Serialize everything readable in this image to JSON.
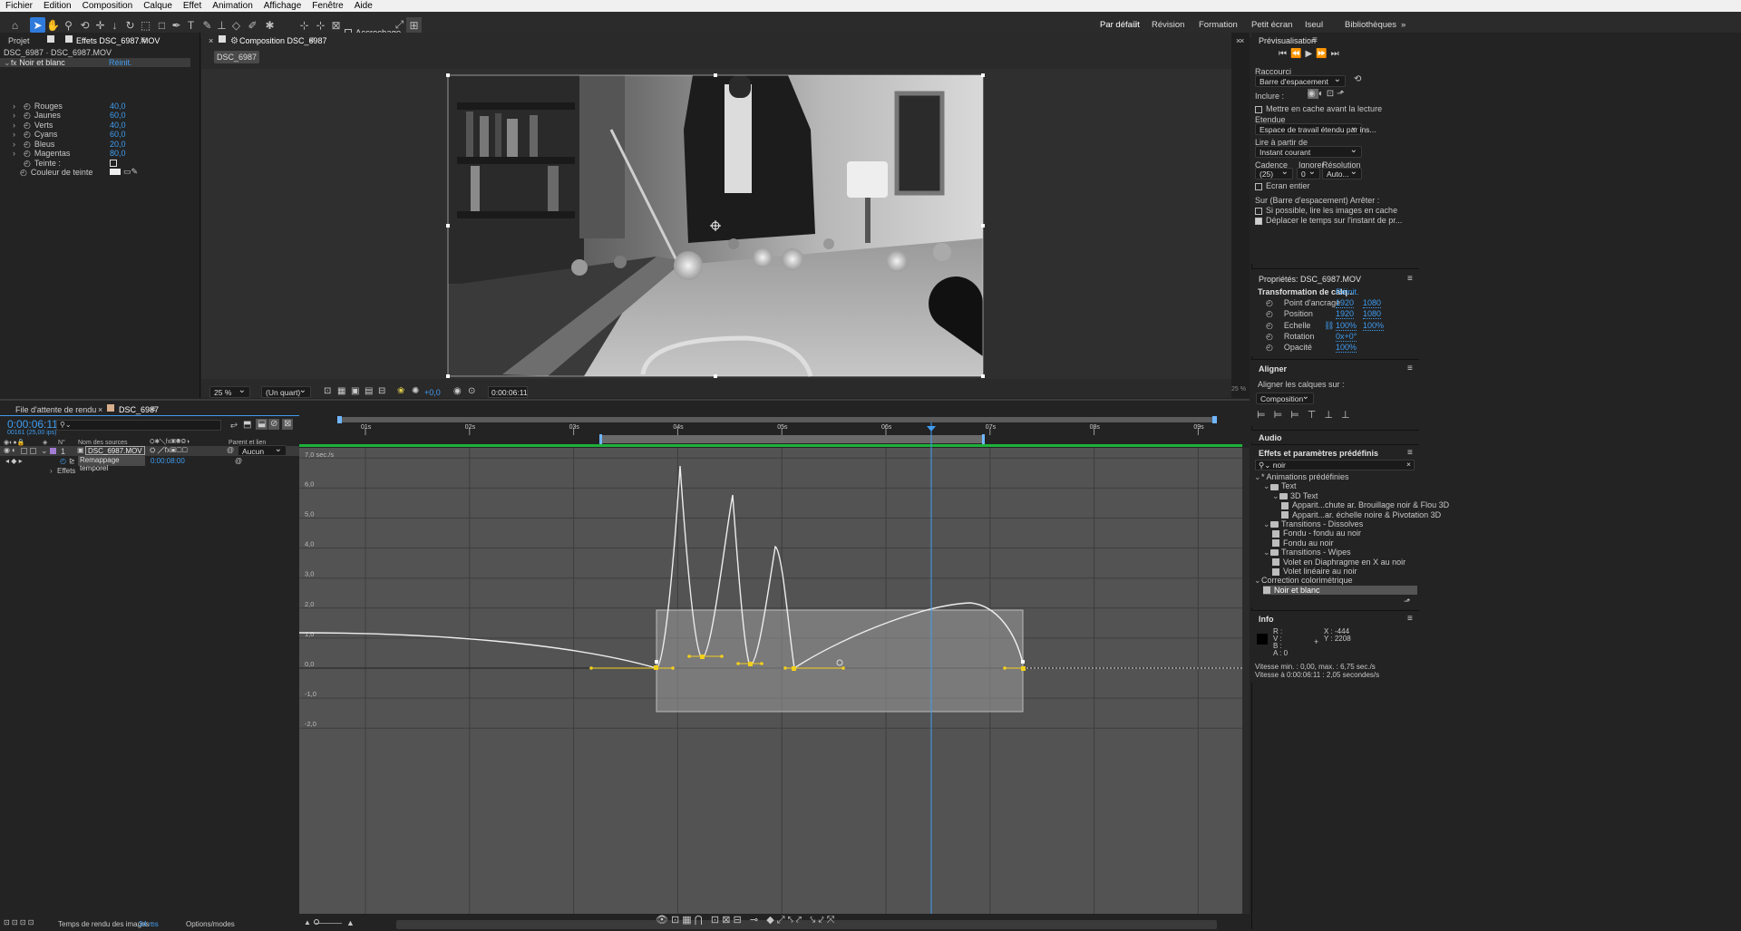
{
  "menu": [
    "Fichier",
    "Edition",
    "Composition",
    "Calque",
    "Effet",
    "Animation",
    "Affichage",
    "Fenêtre",
    "Aide"
  ],
  "toolbar": {
    "snap_label": "Accrochage"
  },
  "workspaces": [
    "Par défaut",
    "Révision",
    "Formation",
    "Petit écran",
    "Iseul",
    "Bibliothèques"
  ],
  "project": {
    "tab_projet": "Projet",
    "tab_effects": "Effets DSC_6987.MOV",
    "layer_path": "DSC_6987 · DSC_6987.MOV",
    "effect_name": "Noir et blanc",
    "reset": "Réinit.",
    "params": [
      {
        "name": "Rouges",
        "value": "40,0"
      },
      {
        "name": "Jaunes",
        "value": "60,0"
      },
      {
        "name": "Verts",
        "value": "40,0"
      },
      {
        "name": "Cyans",
        "value": "60,0"
      },
      {
        "name": "Bleus",
        "value": "20,0"
      },
      {
        "name": "Magentas",
        "value": "80,0"
      }
    ],
    "tint_label": "Teinte :",
    "tint_color_label": "Couleur de teinte"
  },
  "composition": {
    "tab": "Composition DSC_6987",
    "comp_button": "DSC_6987",
    "zoom": "25 %",
    "resolution": "(Un quart)",
    "exposure": "+0,0",
    "timecode": "0:00:06:11",
    "side_zoom": "25 %"
  },
  "timeline": {
    "tab_render": "File d'attente de rendu",
    "tab_comp": "DSC_6987",
    "timecode": "0:00:06:11",
    "frame_info": "00161 (25,00 ips)",
    "col_num": "N°",
    "col_source": "Nom des sources",
    "col_parent": "Parent et lien",
    "layer_num": "1",
    "layer_name": "DSC_6987.MOV",
    "parent": "Aucun",
    "prop_name": "Remappage temporel",
    "prop_value": "0:00:08:00",
    "effects_label": "Effets",
    "ruler": [
      "01s",
      "02s",
      "03s",
      "04s",
      "05s",
      "06s",
      "07s",
      "08s",
      "09s"
    ],
    "graph_labels": [
      "7,0 sec./s",
      "6,0",
      "5,0",
      "4,0",
      "3,0",
      "2,0",
      "1,0",
      "0,0",
      "-1,0",
      "-2,0"
    ],
    "render_time_label": "Temps de rendu des images :",
    "render_time_value": "34 ms",
    "options": "Options/modes"
  },
  "preview": {
    "title": "Prévisualisation",
    "shortcut_label": "Raccourci",
    "shortcut": "Barre d'espacement",
    "include_label": "Inclure :",
    "cache_before": "Mettre en cache avant la lecture",
    "range_label": "Etendue",
    "range": "Espace de travail étendu par ins...",
    "play_from_label": "Lire à partir de",
    "play_from": "Instant courant",
    "rate_label": "Cadence",
    "skip_label": "Ignorer",
    "res_label": "Résolution",
    "rate": "(25)",
    "skip": "0",
    "res": "Auto...",
    "fullscreen": "Ecran entier",
    "stop_label": "Sur (Barre d'espacement) Arrêter :",
    "stop_opt1": "Si possible, lire les images en cache",
    "stop_opt2": "Déplacer le temps sur l'instant de pr..."
  },
  "properties": {
    "title": "Propriétés: DSC_6987.MOV",
    "group": "Transformation de calq...",
    "reset": "Réinit.",
    "rows": [
      {
        "name": "Point d'ancrage",
        "v1": "1920",
        "v2": "1080"
      },
      {
        "name": "Position",
        "v1": "1920",
        "v2": "1080"
      },
      {
        "name": "Echelle",
        "v1": "100%",
        "v2": "100%"
      },
      {
        "name": "Rotation",
        "v1": "0x+0°",
        "v2": ""
      },
      {
        "name": "Opacité",
        "v1": "100%",
        "v2": ""
      }
    ]
  },
  "align": {
    "title": "Aligner",
    "label": "Aligner les calques sur :",
    "target": "Composition"
  },
  "audio": {
    "title": "Audio"
  },
  "effects_presets": {
    "title": "Effets et paramètres prédéfinis",
    "search": "noir",
    "tree": [
      {
        "label": "* Animations prédéfinies",
        "level": 0,
        "type": "root"
      },
      {
        "label": "Text",
        "level": 1,
        "type": "folder"
      },
      {
        "label": "3D Text",
        "level": 2,
        "type": "folder"
      },
      {
        "label": "Apparit...chute ar. Brouillage noir & Flou 3D",
        "level": 3,
        "type": "preset"
      },
      {
        "label": "Apparit...ar. échelle noire & Pivotation 3D",
        "level": 3,
        "type": "preset"
      },
      {
        "label": "Transitions - Dissolves",
        "level": 1,
        "type": "folder"
      },
      {
        "label": "Fondu - fondu au noir",
        "level": 2,
        "type": "preset"
      },
      {
        "label": "Fondu au noir",
        "level": 2,
        "type": "preset"
      },
      {
        "label": "Transitions - Wipes",
        "level": 1,
        "type": "folder"
      },
      {
        "label": "Volet en Diaphragme en X au noir",
        "level": 2,
        "type": "preset"
      },
      {
        "label": "Volet linéaire au noir",
        "level": 2,
        "type": "preset"
      },
      {
        "label": "Correction colorimétrique",
        "level": 0,
        "type": "root"
      },
      {
        "label": "Noir et blanc",
        "level": 1,
        "type": "effect"
      }
    ]
  },
  "info": {
    "title": "Info",
    "r": "R :",
    "v": "V :",
    "b": "B :",
    "a": "A : 0",
    "x": "X : -444",
    "y": "Y : 2208",
    "speed_minmax": "Vitesse min. : 0,00, max. : 6,75 sec./s",
    "speed_at": "Vitesse à 0:00:06:11 : 2,05 secondes/s"
  }
}
